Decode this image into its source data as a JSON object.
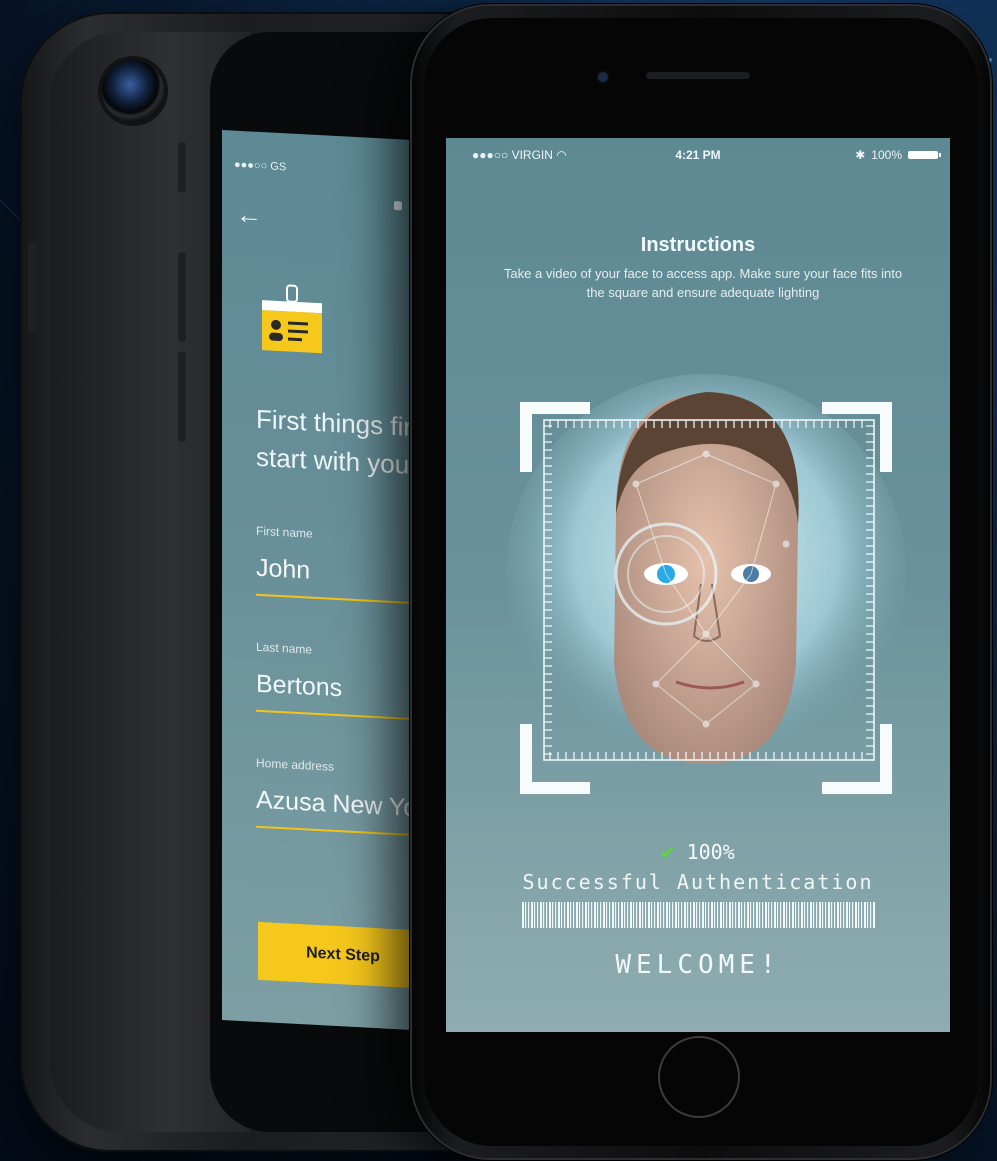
{
  "back_phone": {
    "status_carrier": "●●●○○ GS",
    "back_icon": "arrow-left-icon",
    "badge_icon": "id-badge-icon",
    "heading_line1": "First things first",
    "heading_line2": "start with your d",
    "fields": [
      {
        "label": "First name",
        "value": "John"
      },
      {
        "label": "Last name",
        "value": "Bertons"
      },
      {
        "label": "Home address",
        "value": "Azusa New York"
      }
    ],
    "next_button": "Next Step",
    "accent_color": "#f6c81c"
  },
  "front_phone": {
    "status": {
      "carrier": "●●●○○ VIRGIN",
      "time": "4:21 PM",
      "battery": "100%",
      "icons": [
        "wifi-icon",
        "bluetooth-icon",
        "battery-icon"
      ]
    },
    "instructions_title": "Instructions",
    "instructions_text": "Take a video of your face to access app. Make sure your face fits into the square and ensure adequate lighting",
    "scan_icon": "face-scan-frame",
    "confidence": "100%",
    "check_icon": "check-icon",
    "result_text": "Successful Authentication",
    "welcome_text": "WELCOME!",
    "success_color": "#5cd63c"
  }
}
